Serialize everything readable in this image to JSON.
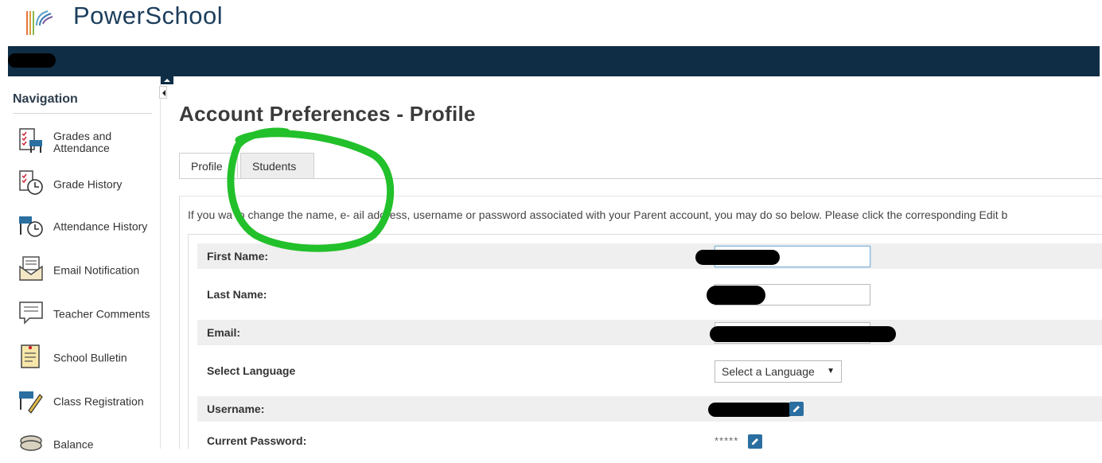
{
  "brand": {
    "name": "PowerSchool"
  },
  "sidebar": {
    "title": "Navigation",
    "items": [
      {
        "label": "Grades and Attendance",
        "icon": "grades-attendance-icon"
      },
      {
        "label": "Grade History",
        "icon": "grade-history-icon"
      },
      {
        "label": "Attendance History",
        "icon": "attendance-history-icon"
      },
      {
        "label": "Email Notification",
        "icon": "email-notification-icon"
      },
      {
        "label": "Teacher Comments",
        "icon": "teacher-comments-icon"
      },
      {
        "label": "School Bulletin",
        "icon": "school-bulletin-icon"
      },
      {
        "label": "Class Registration",
        "icon": "class-registration-icon"
      },
      {
        "label": "Balance",
        "icon": "balance-icon"
      }
    ]
  },
  "main": {
    "title": "Account Preferences - Profile",
    "tabs": [
      {
        "label": "Profile",
        "active": true
      },
      {
        "label": "Students",
        "active": false
      }
    ],
    "intro": "If you wa    to change the name, e-    ail address, username or password associated with your Parent account, you may do so below. Please click the corresponding Edit b",
    "form": {
      "first_name": {
        "label": "First Name:",
        "value": ""
      },
      "last_name": {
        "label": "Last Name:",
        "value": ""
      },
      "email": {
        "label": "Email:",
        "value": ""
      },
      "language": {
        "label": "Select Language",
        "selected": "Select a Language"
      },
      "username": {
        "label": "Username:"
      },
      "current_password": {
        "label": "Current Password:",
        "value": "*****"
      }
    }
  },
  "colors": {
    "brand_navy": "#0f2d45",
    "accent_blue": "#2a6fa0",
    "annotation_green": "#22c02a"
  }
}
